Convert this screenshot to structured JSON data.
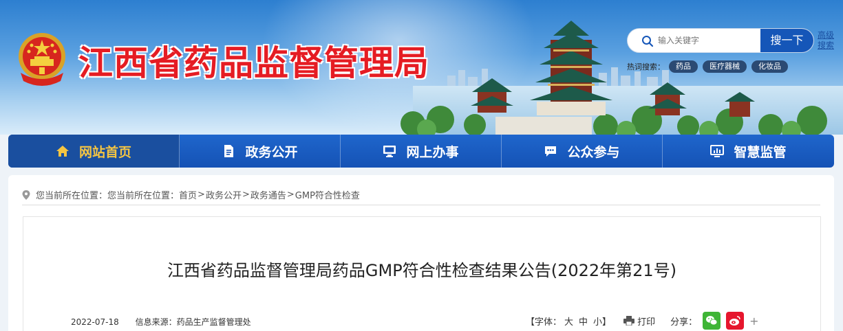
{
  "header": {
    "site_title": "江西省药品监督管理局",
    "search": {
      "placeholder": "输入关键字",
      "button_label": "搜一下",
      "advanced_label": "高级搜索"
    },
    "hot_search": {
      "label": "热词搜索：",
      "tags": [
        "药品",
        "医疗器械",
        "化妆品"
      ]
    }
  },
  "nav": {
    "items": [
      {
        "label": "网站首页",
        "icon": "home-icon"
      },
      {
        "label": "政务公开",
        "icon": "document-icon"
      },
      {
        "label": "网上办事",
        "icon": "monitor-icon"
      },
      {
        "label": "公众参与",
        "icon": "chat-icon"
      },
      {
        "label": "智慧监管",
        "icon": "dashboard-icon"
      }
    ]
  },
  "breadcrumb": {
    "prefix": "您当前所在位置：您当前所在位置：",
    "items": [
      "首页",
      "政务公开",
      "政务通告",
      "GMP符合性检查"
    ],
    "separator": ">"
  },
  "article": {
    "title": "江西省药品监督管理局药品GMP符合性检查结果公告(2022年第21号)",
    "date": "2022-07-18",
    "source": "信息来源：药品生产监督管理处",
    "font_label": "【字体：",
    "font_large": "大",
    "font_medium": "中",
    "font_small": "小】",
    "print_label": "打印",
    "share_label": "分享："
  },
  "colors": {
    "title_red": "#e51c23",
    "nav_blue": "#1552b5",
    "active_gold": "#f5c542"
  }
}
